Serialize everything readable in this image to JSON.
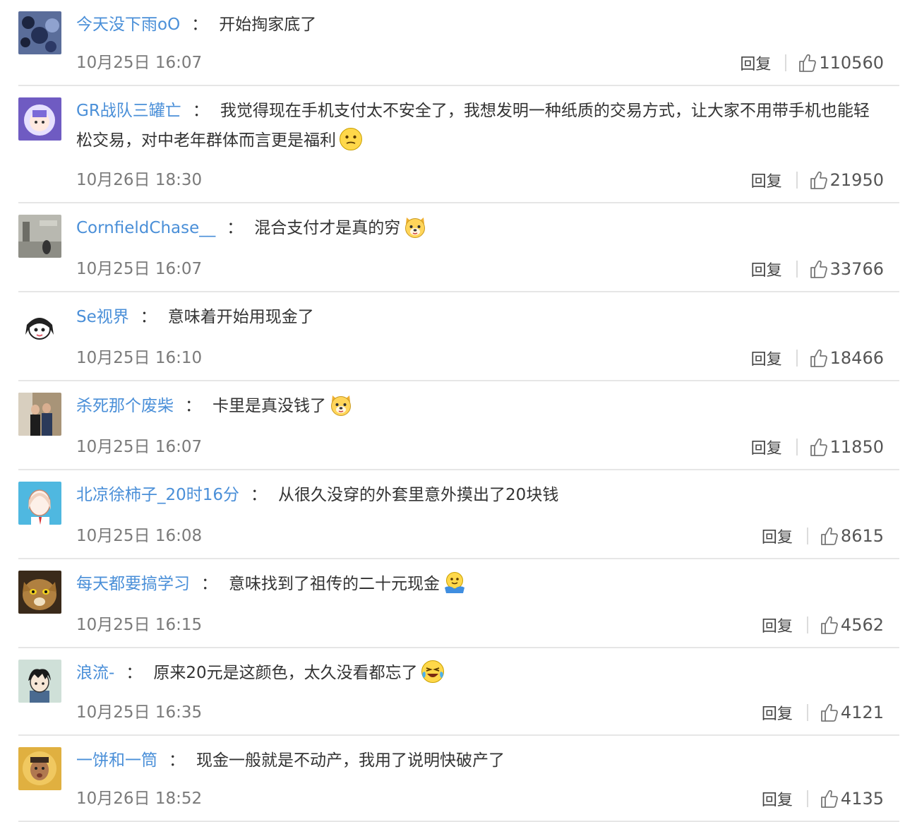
{
  "colors": {
    "username": "#4a8fd8",
    "text": "#333333",
    "time": "#7a7a7a",
    "divider": "#e6e6e6"
  },
  "ui": {
    "separator": "：",
    "reply_label": "回复",
    "like_icon": "thumbs-up-icon"
  },
  "comments": [
    {
      "user": "今天没下雨oO",
      "text": "开始掏家底了",
      "emoji": null,
      "time": "10月25日 16:07",
      "likes": "110560",
      "avatar": "blue-texture"
    },
    {
      "user": "GR战队三罐亡",
      "text": "我觉得现在手机支付太不安全了，我想发明一种纸质的交易方式，让大家不用带手机也能轻松交易，对中老年群体而言更是福利",
      "emoji": "thinking-face",
      "time": "10月26日 18:30",
      "likes": "21950",
      "avatar": "anime-girl"
    },
    {
      "user": "CornfieldChase__",
      "text": "混合支付才是真的穷",
      "emoji": "doge-face",
      "time": "10月25日 16:07",
      "likes": "33766",
      "avatar": "street-photo"
    },
    {
      "user": "Se视界",
      "text": "意味着开始用现金了",
      "emoji": null,
      "time": "10月25日 16:10",
      "likes": "18466",
      "avatar": "cartoon-girl"
    },
    {
      "user": "杀死那个废柴",
      "text": "卡里是真没钱了",
      "emoji": "doge-face",
      "time": "10月25日 16:07",
      "likes": "11850",
      "avatar": "couple-photo"
    },
    {
      "user": "北凉徐柿子_20时16分",
      "text": "从很久没穿的外套里意外摸出了20块钱",
      "emoji": null,
      "time": "10月25日 16:08",
      "likes": "8615",
      "avatar": "cartoon-man"
    },
    {
      "user": "每天都要搞学习",
      "text": "意味找到了祖传的二十元现金",
      "emoji": "hug-face",
      "time": "10月25日 16:15",
      "likes": "4562",
      "avatar": "cat-photo"
    },
    {
      "user": "浪流-",
      "text": "原来20元是这颜色，太久没看都忘了",
      "emoji": "laugh-cry-face",
      "time": "10月25日 16:35",
      "likes": "4121",
      "avatar": "cartoon-boy"
    },
    {
      "user": "一饼和一筒",
      "text": "现金一般就是不动产，我用了说明快破产了",
      "emoji": null,
      "time": "10月26日 18:52",
      "likes": "4135",
      "avatar": "kid-photo"
    }
  ]
}
